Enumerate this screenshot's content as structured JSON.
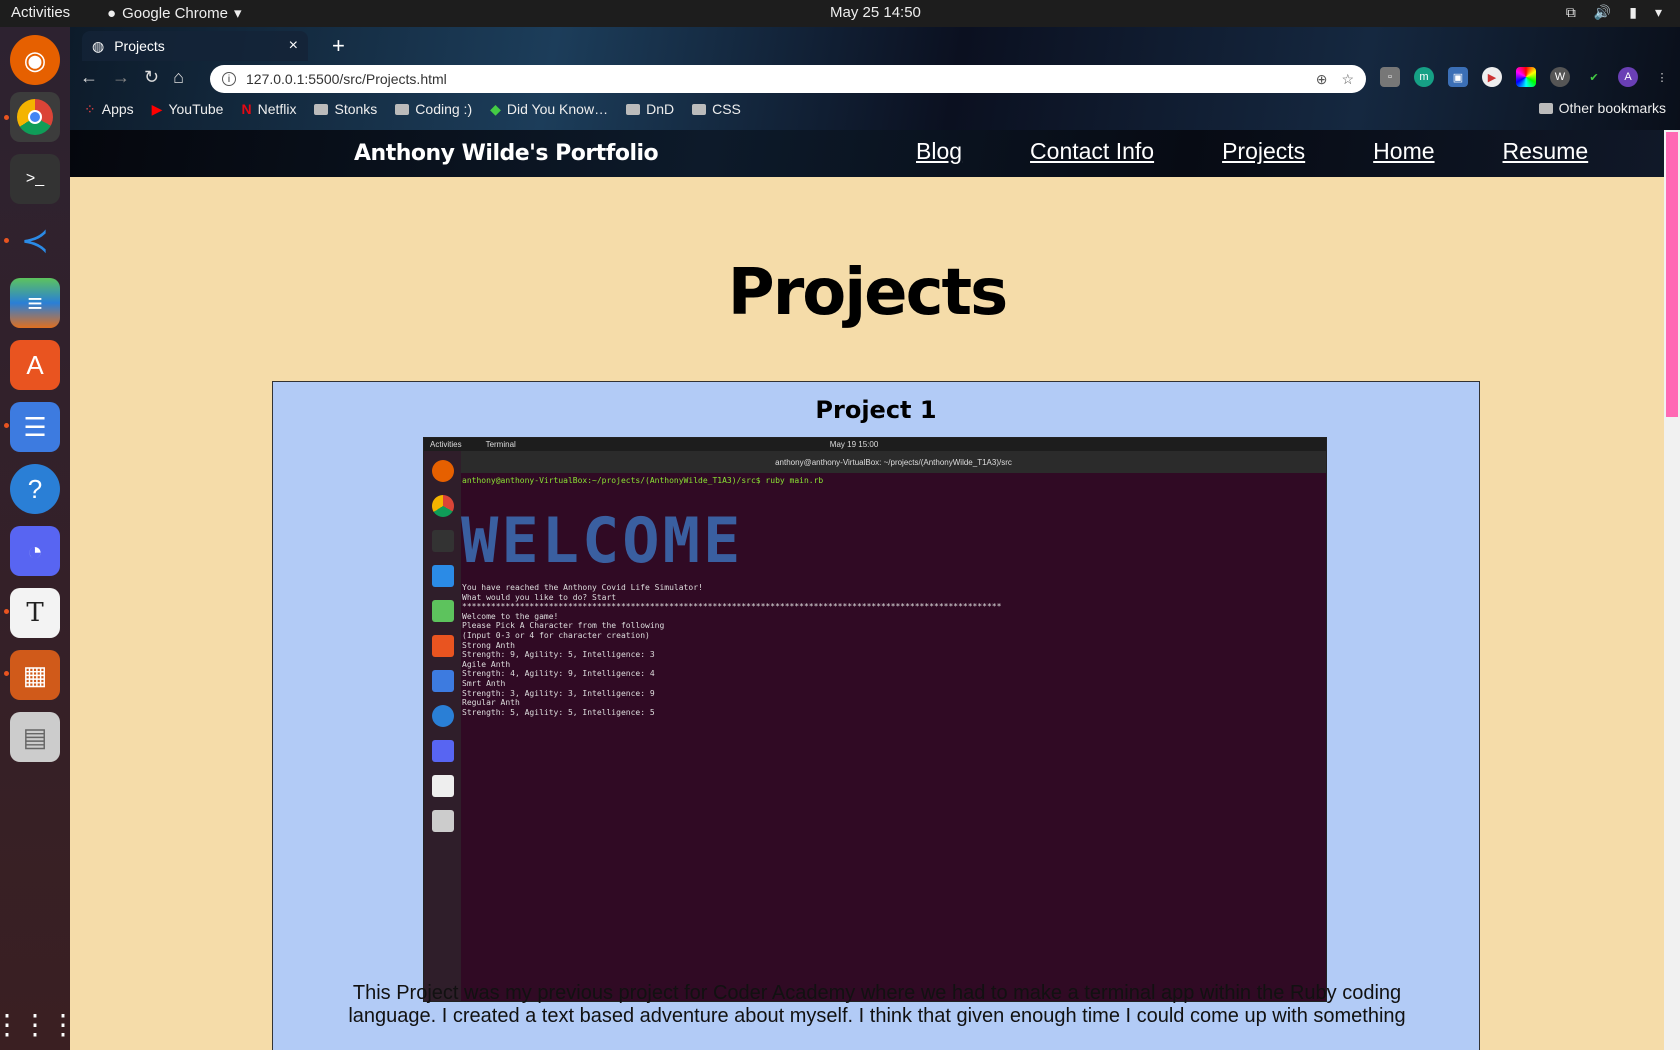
{
  "topbar": {
    "activities": "Activities",
    "app": "Google Chrome",
    "clock": "May 25  14:50"
  },
  "dock": {
    "apps": [
      "Firefox",
      "Chrome",
      "Terminal",
      "VS Code",
      "Layers",
      "App Store",
      "Files",
      "Help",
      "Discord",
      "Typora",
      "Impress",
      "Archive",
      "Show Apps"
    ]
  },
  "browser": {
    "tab_title": "Projects",
    "url": "127.0.0.1:5500/src/Projects.html",
    "bookmarks": [
      "Apps",
      "YouTube",
      "Netflix",
      "Stonks",
      "Coding :)",
      "Did You Know…",
      "DnD",
      "CSS"
    ],
    "other_bookmarks": "Other bookmarks"
  },
  "site": {
    "brand": "Anthony Wilde's Portfolio",
    "nav": [
      "Blog",
      "Contact Info",
      "Projects",
      "Home",
      "Resume"
    ],
    "page_title": "Projects",
    "project": {
      "title": "Project 1",
      "desc": "This Project was my previous project for Coder Academy where we had to make a terminal app within the Ruby coding language. I created a text based adventure about myself. I think that given enough time I could come up with something"
    }
  },
  "screenshot": {
    "top_left": "Activities",
    "top_app": "Terminal",
    "top_clock": "May 19  15:00",
    "window_title": "anthony@anthony-VirtualBox: ~/projects/(AnthonyWilde_T1A3)/src",
    "prompt": "anthony@anthony-VirtualBox:~/projects/(AnthonyWilde_T1A3)/src$ ruby main.rb",
    "welcome": "WELCOME",
    "lines": "You have reached the Anthony Covid Life Simulator!\nWhat would you like to do? Start\n****************************************************************************************************************\nWelcome to the game!\nPlease Pick A Character from the following\n(Input 0-3 or 4 for character creation)\nStrong Anth\nStrength: 9, Agility: 5, Intelligence: 3\nAgile Anth\nStrength: 4, Agility: 9, Intelligence: 4\nSmrt Anth\nStrength: 3, Agility: 3, Intelligence: 9\nRegular Anth\nStrength: 5, Agility: 5, Intelligence: 5"
  },
  "colors": {
    "page_bg": "#f5dca9",
    "card_bg": "#b2cbf6",
    "terminal_bg": "#300a24",
    "scroll_thumb": "#ff69b4"
  }
}
